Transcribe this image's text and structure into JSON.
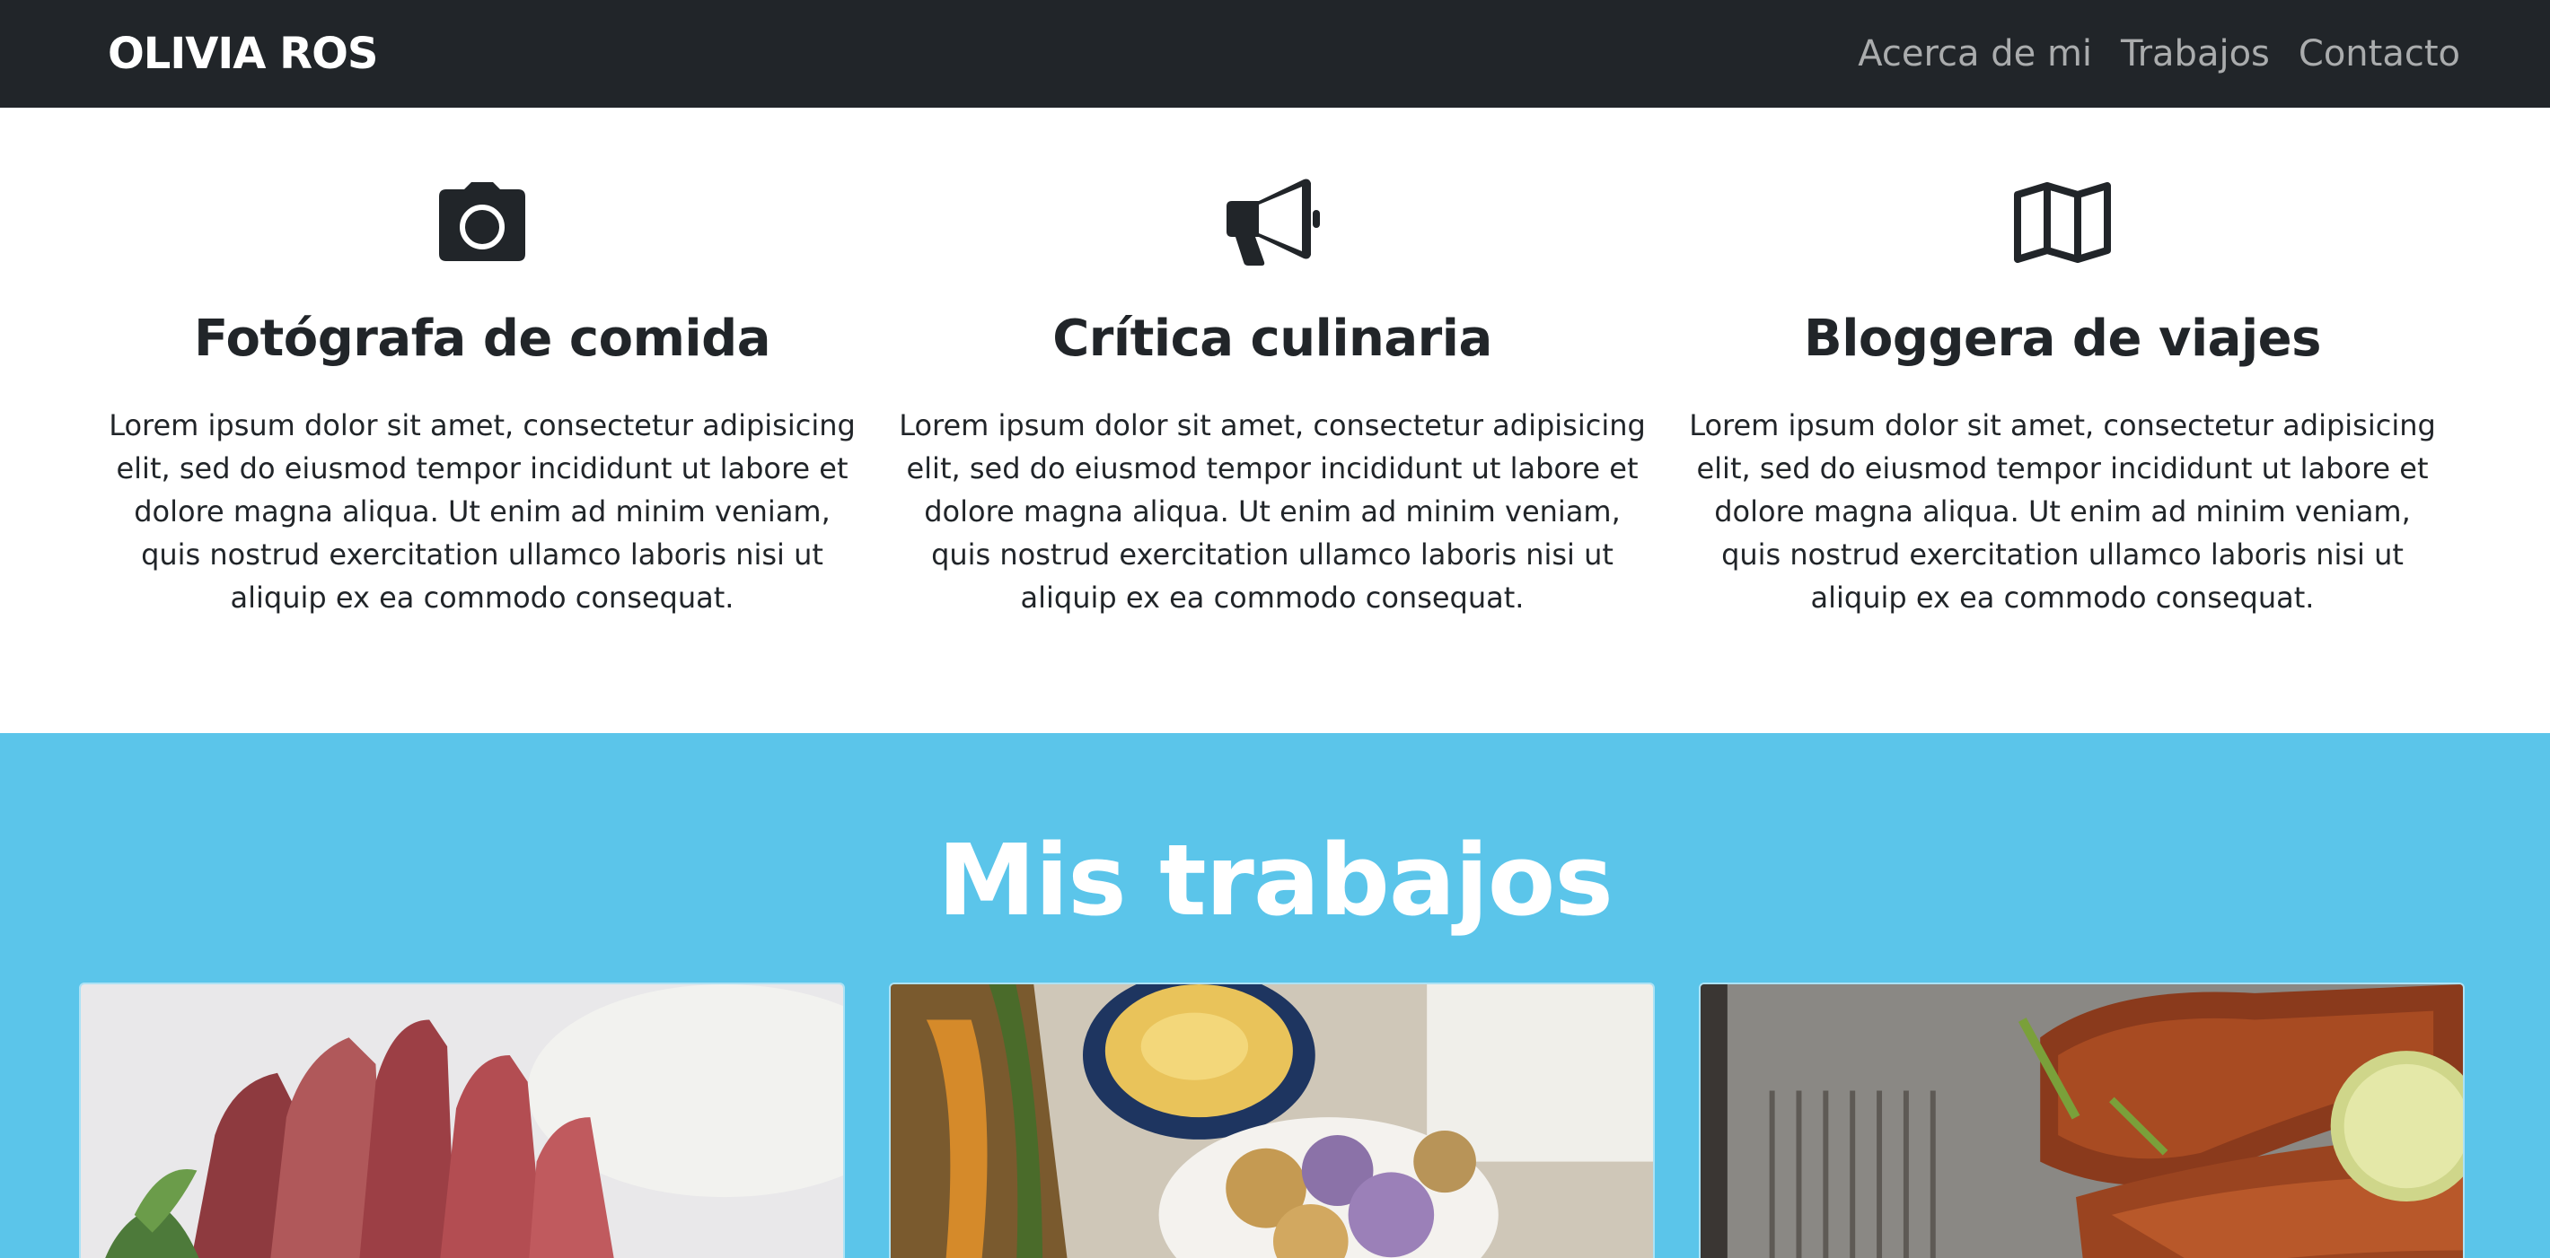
{
  "navbar": {
    "brand": "OLIVIA ROS",
    "links": [
      {
        "label": "Acerca de mi"
      },
      {
        "label": "Trabajos"
      },
      {
        "label": "Contacto"
      }
    ]
  },
  "services": [
    {
      "icon": "camera-icon",
      "title": "Fotógrafa de comida",
      "text": "Lorem ipsum dolor sit amet, consectetur adipisicing elit, sed do eiusmod tempor incididunt ut labore et dolore magna aliqua. Ut enim ad minim veniam, quis nostrud exercitation ullamco laboris nisi ut aliquip ex ea commodo consequat."
    },
    {
      "icon": "megaphone-icon",
      "title": "Crítica culinaria",
      "text": "Lorem ipsum dolor sit amet, consectetur adipisicing elit, sed do eiusmod tempor incididunt ut labore et dolore magna aliqua. Ut enim ad minim veniam, quis nostrud exercitation ullamco laboris nisi ut aliquip ex ea commodo consequat."
    },
    {
      "icon": "map-icon",
      "title": "Bloggera de viajes",
      "text": "Lorem ipsum dolor sit amet, consectetur adipisicing elit, sed do eiusmod tempor incididunt ut labore et dolore magna aliqua. Ut enim ad minim veniam, quis nostrud exercitation ullamco laboris nisi ut aliquip ex ea commodo consequat."
    }
  ],
  "portfolio": {
    "title": "Mis trabajos",
    "cards": [
      {
        "image": "seared-tuna-photo"
      },
      {
        "image": "vegetables-and-dip-photo"
      },
      {
        "image": "glazed-salmon-photo"
      }
    ]
  },
  "colors": {
    "navbar_bg": "#212529",
    "nav_link": "#9fa1a3",
    "accent_bg": "#5bc5ea",
    "text": "#212529"
  }
}
